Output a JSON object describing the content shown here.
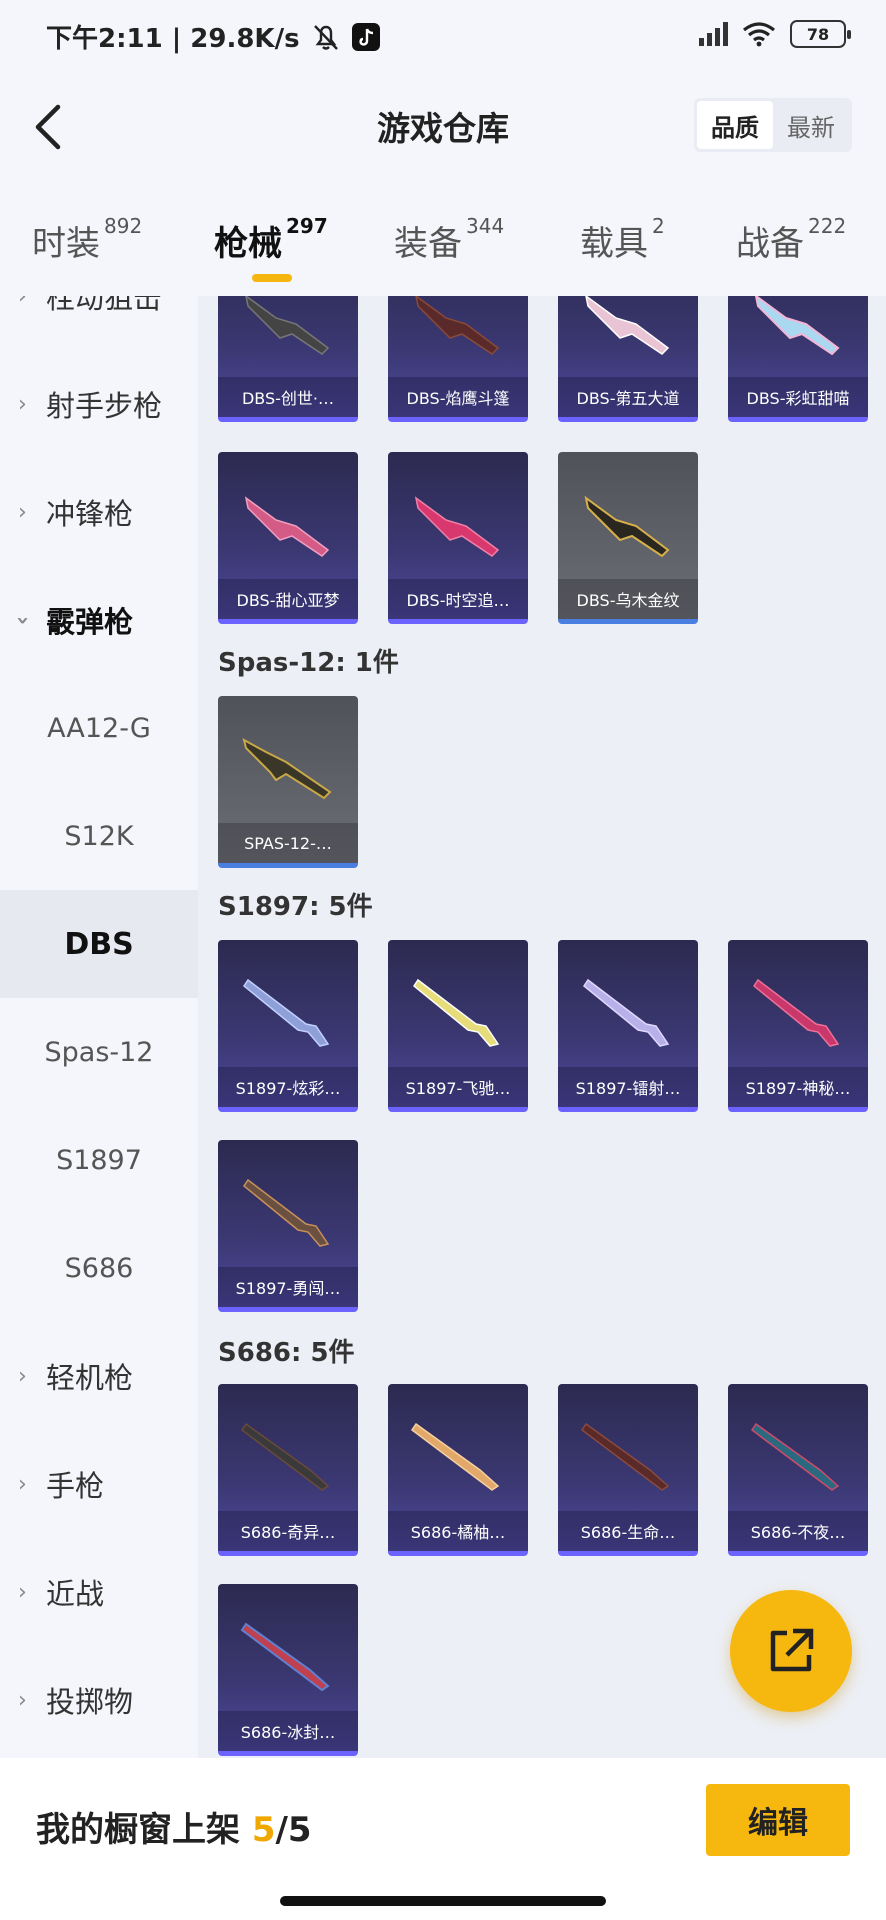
{
  "status_bar": {
    "time_text": "下午2:11 | 29.8K/s",
    "battery": "78"
  },
  "header": {
    "title": "游戏仓库",
    "sort_options": [
      "品质",
      "最新"
    ]
  },
  "tabs": [
    {
      "label": "时装",
      "count": "892"
    },
    {
      "label": "枪械",
      "count": "297"
    },
    {
      "label": "装备",
      "count": "344"
    },
    {
      "label": "载具",
      "count": "2"
    },
    {
      "label": "战备",
      "count": "222"
    }
  ],
  "sidebar": [
    {
      "label": "栓动狙击"
    },
    {
      "label": "射手步枪"
    },
    {
      "label": "冲锋枪"
    },
    {
      "label": "霰弹枪"
    },
    {
      "label": "AA12-G"
    },
    {
      "label": "S12K"
    },
    {
      "label": "DBS"
    },
    {
      "label": "Spas-12"
    },
    {
      "label": "S1897"
    },
    {
      "label": "S686"
    },
    {
      "label": "轻机枪"
    },
    {
      "label": "手枪"
    },
    {
      "label": "近战"
    },
    {
      "label": "投掷物"
    }
  ],
  "sections": {
    "dbs_items": [
      "DBS-创世·…",
      "DBS-焰鹰斗篷",
      "DBS-第五大道",
      "DBS-彩虹甜喵",
      "DBS-甜心亚梦",
      "DBS-时空追…",
      "DBS-乌木金纹"
    ],
    "spas": {
      "header": "Spas-12: 1件",
      "items": [
        "SPAS-12-…"
      ]
    },
    "s1897": {
      "header": "S1897: 5件",
      "items": [
        "S1897-炫彩…",
        "S1897-飞驰…",
        "S1897-镭射…",
        "S1897-神秘…",
        "S1897-勇闯…"
      ]
    },
    "s686": {
      "header": "S686: 5件",
      "items": [
        "S686-奇异…",
        "S686-橘柚…",
        "S686-生命…",
        "S686-不夜…",
        "S686-冰封…"
      ]
    }
  },
  "footer": {
    "prefix": "我的橱窗上架 ",
    "count_current": "5",
    "count_total": "/5",
    "edit_label": "编辑"
  },
  "colors": {
    "accent": "#f6b80f",
    "card_purple": "#3b3873",
    "card_grey": "#6c6e75"
  }
}
